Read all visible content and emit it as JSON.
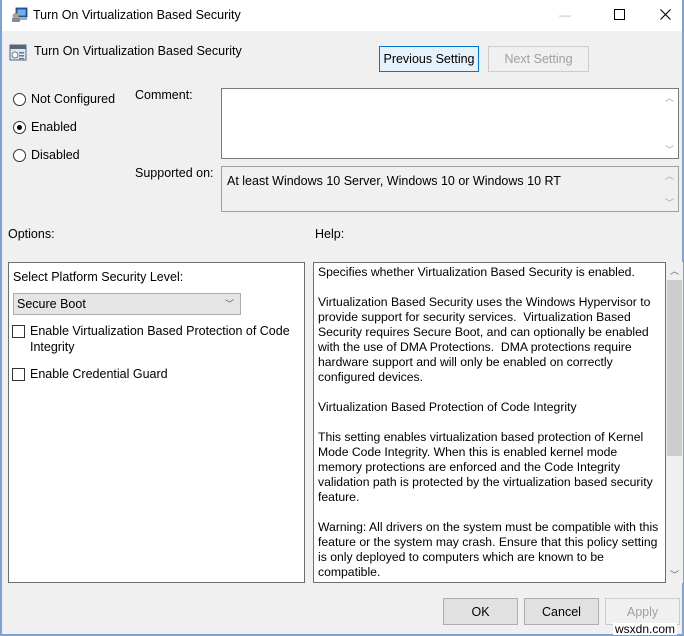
{
  "window": {
    "title": "Turn On Virtualization Based Security",
    "controls": {
      "minimize": "—",
      "maximize": "☐",
      "close": "✕"
    }
  },
  "header": {
    "policy_name": "Turn On Virtualization Based Security",
    "previous_label": "Previous Setting",
    "next_label": "Next Setting"
  },
  "state": {
    "options": [
      {
        "label": "Not Configured",
        "checked": false
      },
      {
        "label": "Enabled",
        "checked": true
      },
      {
        "label": "Disabled",
        "checked": false
      }
    ]
  },
  "comment": {
    "label": "Comment:",
    "value": ""
  },
  "supported": {
    "label": "Supported on:",
    "value": "At least Windows 10 Server, Windows 10 or Windows 10 RT"
  },
  "options_section": {
    "label": "Options:",
    "platform_label": "Select Platform Security Level:",
    "platform_value": "Secure Boot",
    "checkboxes": [
      {
        "label": "Enable Virtualization Based Protection of Code Integrity",
        "checked": false
      },
      {
        "label": "Enable Credential Guard",
        "checked": false
      }
    ]
  },
  "help_section": {
    "label": "Help:",
    "text": "Specifies whether Virtualization Based Security is enabled.\n\nVirtualization Based Security uses the Windows Hypervisor to provide support for security services.  Virtualization Based Security requires Secure Boot, and can optionally be enabled with the use of DMA Protections.  DMA protections require hardware support and will only be enabled on correctly configured devices.\n\nVirtualization Based Protection of Code Integrity\n\nThis setting enables virtualization based protection of Kernel Mode Code Integrity. When this is enabled kernel mode memory protections are enforced and the Code Integrity validation path is protected by the virtualization based security feature.\n\nWarning: All drivers on the system must be compatible with this feature or the system may crash. Ensure that this policy setting is only deployed to computers which are known to be compatible.\n\nCredential Guard"
  },
  "footer": {
    "ok_label": "OK",
    "cancel_label": "Cancel",
    "apply_label": "Apply"
  },
  "watermark": "wsxdn.com",
  "colors": {
    "accent": "#0078d7",
    "frame": "#7fa2cf"
  }
}
